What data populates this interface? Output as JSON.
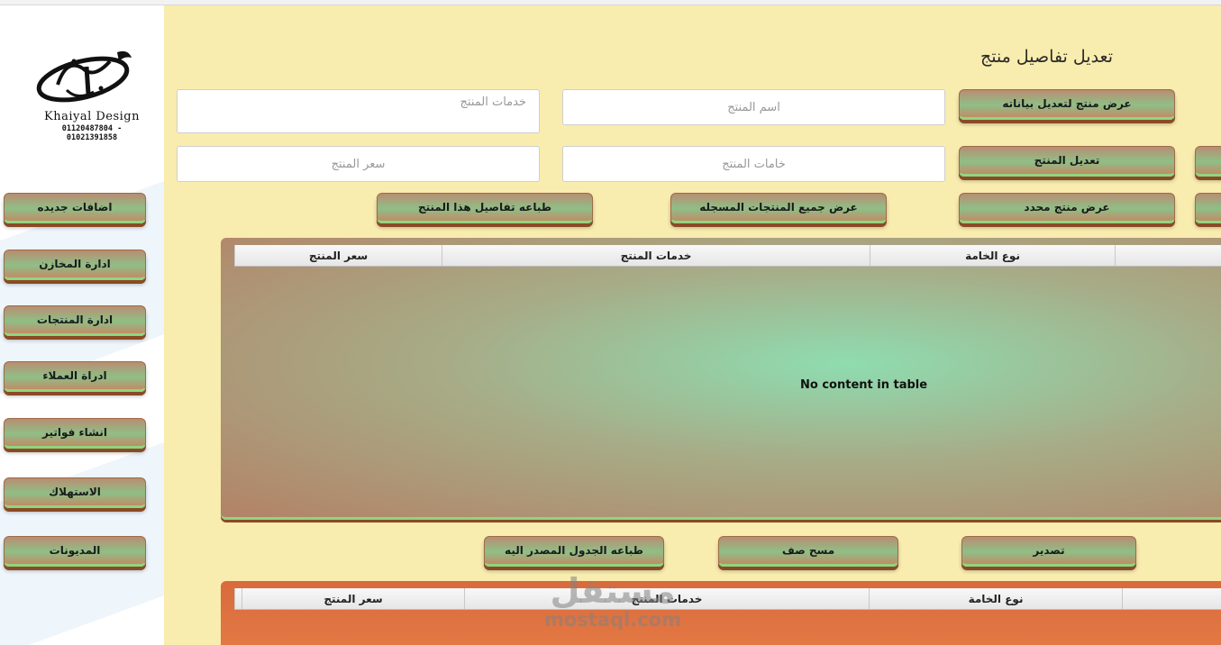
{
  "logo": {
    "name": "Khaiyal Design",
    "phones": "01120487804 - 01021391858"
  },
  "sidebar": {
    "items": [
      {
        "label": "اضافات جديده"
      },
      {
        "label": "ادارة المخازن"
      },
      {
        "label": "ادارة المنتجات"
      },
      {
        "label": "ادراة العملاء"
      },
      {
        "label": "انشاء فواتير"
      },
      {
        "label": "الاستهلاك"
      },
      {
        "label": "المديونات"
      }
    ]
  },
  "page": {
    "title": "تعديل تفاصيل منتج"
  },
  "form": {
    "product_services_placeholder": "خدمات المنتج",
    "product_name_placeholder": "اسم المنتج",
    "product_price_placeholder": "سعر المنتج",
    "product_materials_placeholder": "خامات المنتج"
  },
  "actions": {
    "show_product_to_edit": "عرض منتج لتعديل بياناته",
    "edit_product": "تعديل المنتج",
    "show_specific_product": "عرض منتج محدد",
    "show_all_products": "عرض جميع المنتجات المسجله",
    "print_product_details": "طباعه تفاصيل هذا المنتج"
  },
  "table": {
    "columns": [
      "نوع الخامة",
      "خدمات المنتج",
      "سعر المنتج"
    ],
    "empty_message": "No content in table"
  },
  "table_actions": {
    "export": "تصدير",
    "clear_row": "مسح صف",
    "print_source_table": "طباعه الجدول المصدر اليه"
  },
  "watermark": {
    "arabic": "مستقل",
    "latin": "mostaql.com"
  },
  "colors": {
    "panel_bg": "#f8ecae",
    "button_accent": "#8fd67e",
    "button_shadow": "#8a4a26",
    "table2_bg": "#e0703f"
  }
}
